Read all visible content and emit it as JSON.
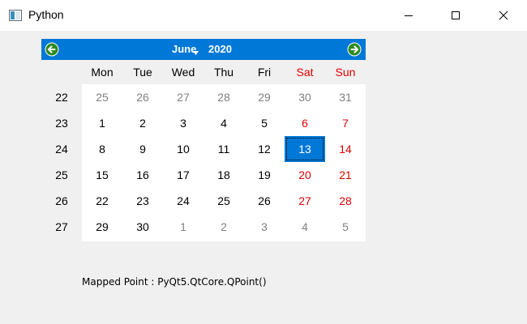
{
  "window": {
    "title": "Python"
  },
  "calendar": {
    "month": "June",
    "year": "2020",
    "headers": [
      "Mon",
      "Tue",
      "Wed",
      "Thu",
      "Fri",
      "Sat",
      "Sun"
    ],
    "weeks": [
      {
        "week": "22",
        "days": [
          "25",
          "26",
          "27",
          "28",
          "29",
          "30",
          "31"
        ],
        "outside": [
          true,
          true,
          true,
          true,
          true,
          true,
          true
        ]
      },
      {
        "week": "23",
        "days": [
          "1",
          "2",
          "3",
          "4",
          "5",
          "6",
          "7"
        ],
        "outside": [
          false,
          false,
          false,
          false,
          false,
          false,
          false
        ]
      },
      {
        "week": "24",
        "days": [
          "8",
          "9",
          "10",
          "11",
          "12",
          "13",
          "14"
        ],
        "outside": [
          false,
          false,
          false,
          false,
          false,
          false,
          false
        ]
      },
      {
        "week": "25",
        "days": [
          "15",
          "16",
          "17",
          "18",
          "19",
          "20",
          "21"
        ],
        "outside": [
          false,
          false,
          false,
          false,
          false,
          false,
          false
        ]
      },
      {
        "week": "26",
        "days": [
          "22",
          "23",
          "24",
          "25",
          "26",
          "27",
          "28"
        ],
        "outside": [
          false,
          false,
          false,
          false,
          false,
          false,
          false
        ]
      },
      {
        "week": "27",
        "days": [
          "29",
          "30",
          "1",
          "2",
          "3",
          "4",
          "5"
        ],
        "outside": [
          false,
          false,
          true,
          true,
          true,
          true,
          true
        ]
      }
    ],
    "selected_day": "13",
    "colors": {
      "accent": "#0078d7",
      "weekend": "#e00000",
      "muted": "#808080"
    }
  },
  "status": {
    "text": "Mapped Point : PyQt5.QtCore.QPoint()"
  }
}
